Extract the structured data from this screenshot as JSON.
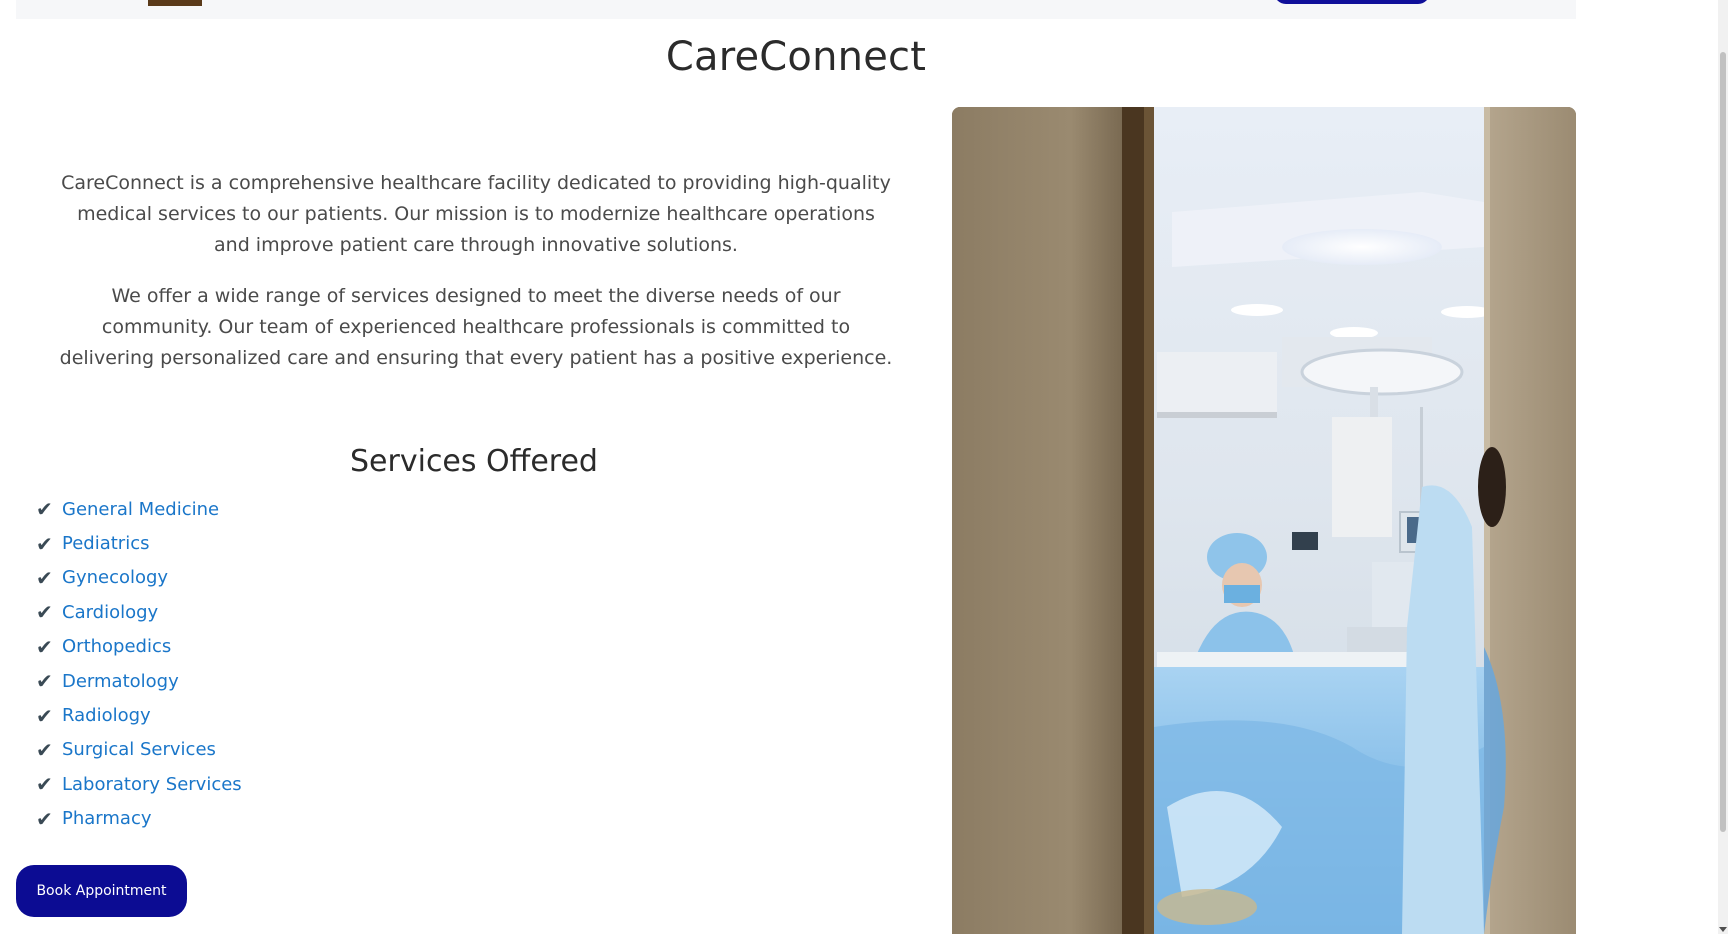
{
  "page": {
    "title": "CareConnect"
  },
  "about": {
    "paragraphs": [
      "CareConnect is a comprehensive healthcare facility dedicated to providing high-quality medical services to our patients. Our mission is to modernize healthcare operations and improve patient care through innovative solutions.",
      "We offer a wide range of services designed to meet the diverse needs of our community. Our team of experienced healthcare professionals is committed to delivering personalized care and ensuring that every patient has a positive experience."
    ]
  },
  "services": {
    "heading": "Services Offered",
    "check_glyph": "✔",
    "items": [
      "General Medicine",
      "Pediatrics",
      "Gynecology",
      "Cardiology",
      "Orthopedics",
      "Dermatology",
      "Radiology",
      "Surgical Services",
      "Laboratory Services",
      "Pharmacy"
    ]
  },
  "cta": {
    "book_label": "Book Appointment"
  },
  "colors": {
    "link": "#1a76c9",
    "button": "#0c0c93",
    "heading": "#2b2b2b",
    "body_text": "#4a4a4a"
  },
  "icons": {
    "check": "check-icon"
  }
}
